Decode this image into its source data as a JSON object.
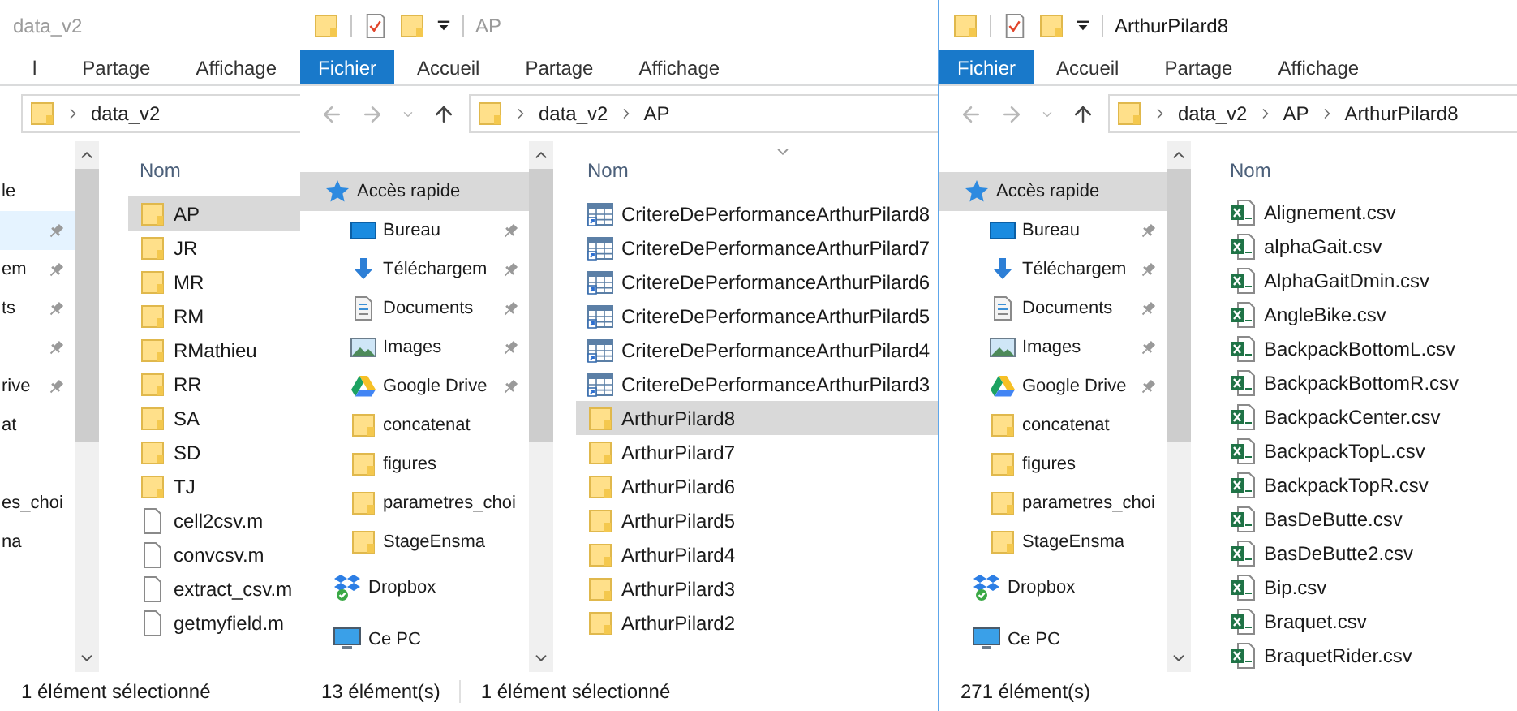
{
  "windows": [
    {
      "title": "data_v2",
      "active": false,
      "ribbon_tabs": [
        {
          "label": "l",
          "kind": "tab"
        },
        {
          "label": "Partage",
          "kind": "tab"
        },
        {
          "label": "Affichage",
          "kind": "tab"
        }
      ],
      "breadcrumb": [
        "data_v2"
      ],
      "sidebar": [
        {
          "label": "le",
          "kind": "text",
          "pinned": false,
          "selected": false,
          "hovered": false
        },
        {
          "kind": "text",
          "pinned": true,
          "selected": false,
          "hovered": true
        },
        {
          "label": "em",
          "kind": "text",
          "pinned": true,
          "selected": false,
          "hovered": false
        },
        {
          "label": "ts",
          "kind": "text",
          "pinned": true,
          "selected": false,
          "hovered": false
        },
        {
          "kind": "text",
          "pinned": true,
          "selected": false,
          "hovered": false
        },
        {
          "label": "rive",
          "kind": "text",
          "pinned": true,
          "selected": false,
          "hovered": false
        },
        {
          "label": "at",
          "kind": "text",
          "pinned": false,
          "selected": false,
          "hovered": false
        },
        {
          "kind": "text",
          "pinned": false,
          "selected": false,
          "hovered": false
        },
        {
          "label": "es_choi",
          "kind": "text",
          "pinned": false,
          "selected": false,
          "hovered": false
        },
        {
          "label": "na",
          "kind": "text",
          "pinned": false,
          "selected": false,
          "hovered": false
        }
      ],
      "column_header": "Nom",
      "files": [
        {
          "name": "AP",
          "kind": "folder",
          "selected": true
        },
        {
          "name": "JR",
          "kind": "folder",
          "selected": false
        },
        {
          "name": "MR",
          "kind": "folder",
          "selected": false
        },
        {
          "name": "RM",
          "kind": "folder",
          "selected": false
        },
        {
          "name": "RMathieu",
          "kind": "folder",
          "selected": false
        },
        {
          "name": "RR",
          "kind": "folder",
          "selected": false
        },
        {
          "name": "SA",
          "kind": "folder",
          "selected": false
        },
        {
          "name": "SD",
          "kind": "folder",
          "selected": false
        },
        {
          "name": "TJ",
          "kind": "folder",
          "selected": false
        },
        {
          "name": "cell2csv.m",
          "kind": "file",
          "selected": false
        },
        {
          "name": "convcsv.m",
          "kind": "file",
          "selected": false
        },
        {
          "name": "extract_csv.m",
          "kind": "file",
          "selected": false
        },
        {
          "name": "getmyfield.m",
          "kind": "file",
          "selected": false
        }
      ],
      "status": [
        "1 élément sélectionné"
      ]
    },
    {
      "title": "AP",
      "active": false,
      "ribbon_tabs": [
        {
          "label": "Fichier",
          "kind": "file"
        },
        {
          "label": "Accueil",
          "kind": "tab"
        },
        {
          "label": "Partage",
          "kind": "tab"
        },
        {
          "label": "Affichage",
          "kind": "tab"
        }
      ],
      "breadcrumb": [
        "data_v2",
        "AP"
      ],
      "sidebar": [
        {
          "label": "Accès rapide",
          "kind": "quick-access",
          "pinned": false,
          "selected": true
        },
        {
          "label": "Bureau",
          "kind": "desktop",
          "pinned": true,
          "selected": false
        },
        {
          "label": "Téléchargem",
          "kind": "downloads",
          "pinned": true,
          "selected": false
        },
        {
          "label": "Documents",
          "kind": "documents",
          "pinned": true,
          "selected": false
        },
        {
          "label": "Images",
          "kind": "images",
          "pinned": true,
          "selected": false
        },
        {
          "label": "Google Drive",
          "kind": "drive",
          "pinned": true,
          "selected": false
        },
        {
          "label": "concatenat",
          "kind": "folder",
          "pinned": false,
          "selected": false
        },
        {
          "label": "figures",
          "kind": "folder",
          "pinned": false,
          "selected": false
        },
        {
          "label": "parametres_choi",
          "kind": "folder",
          "pinned": false,
          "selected": false
        },
        {
          "label": "StageEnsma",
          "kind": "folder",
          "pinned": false,
          "selected": false
        },
        {
          "label": "Dropbox",
          "kind": "dropbox",
          "pinned": false,
          "selected": false
        },
        {
          "label": "Ce PC",
          "kind": "pc",
          "pinned": false,
          "selected": false
        }
      ],
      "column_header": "Nom",
      "files": [
        {
          "name": "CritereDePerformanceArthurPilard8",
          "kind": "table",
          "selected": false
        },
        {
          "name": "CritereDePerformanceArthurPilard7",
          "kind": "table",
          "selected": false
        },
        {
          "name": "CritereDePerformanceArthurPilard6",
          "kind": "table",
          "selected": false
        },
        {
          "name": "CritereDePerformanceArthurPilard5",
          "kind": "table",
          "selected": false
        },
        {
          "name": "CritereDePerformanceArthurPilard4",
          "kind": "table",
          "selected": false
        },
        {
          "name": "CritereDePerformanceArthurPilard3",
          "kind": "table",
          "selected": false
        },
        {
          "name": "ArthurPilard8",
          "kind": "folder",
          "selected": true
        },
        {
          "name": "ArthurPilard7",
          "kind": "folder",
          "selected": false
        },
        {
          "name": "ArthurPilard6",
          "kind": "folder",
          "selected": false
        },
        {
          "name": "ArthurPilard5",
          "kind": "folder",
          "selected": false
        },
        {
          "name": "ArthurPilard4",
          "kind": "folder",
          "selected": false
        },
        {
          "name": "ArthurPilard3",
          "kind": "folder",
          "selected": false
        },
        {
          "name": "ArthurPilard2",
          "kind": "folder",
          "selected": false
        }
      ],
      "status": [
        "13 élément(s)",
        "1 élément sélectionné"
      ]
    },
    {
      "title": "ArthurPilard8",
      "active": true,
      "ribbon_tabs": [
        {
          "label": "Fichier",
          "kind": "file"
        },
        {
          "label": "Accueil",
          "kind": "tab"
        },
        {
          "label": "Partage",
          "kind": "tab"
        },
        {
          "label": "Affichage",
          "kind": "tab"
        }
      ],
      "breadcrumb": [
        "data_v2",
        "AP",
        "ArthurPilard8"
      ],
      "sidebar": [
        {
          "label": "Accès rapide",
          "kind": "quick-access",
          "pinned": false,
          "selected": true
        },
        {
          "label": "Bureau",
          "kind": "desktop",
          "pinned": true,
          "selected": false
        },
        {
          "label": "Téléchargem",
          "kind": "downloads",
          "pinned": true,
          "selected": false
        },
        {
          "label": "Documents",
          "kind": "documents",
          "pinned": true,
          "selected": false
        },
        {
          "label": "Images",
          "kind": "images",
          "pinned": true,
          "selected": false
        },
        {
          "label": "Google Drive",
          "kind": "drive",
          "pinned": true,
          "selected": false
        },
        {
          "label": "concatenat",
          "kind": "folder",
          "pinned": false,
          "selected": false
        },
        {
          "label": "figures",
          "kind": "folder",
          "pinned": false,
          "selected": false
        },
        {
          "label": "parametres_choi",
          "kind": "folder",
          "pinned": false,
          "selected": false
        },
        {
          "label": "StageEnsma",
          "kind": "folder",
          "pinned": false,
          "selected": false
        },
        {
          "label": "Dropbox",
          "kind": "dropbox",
          "pinned": false,
          "selected": false
        },
        {
          "label": "Ce PC",
          "kind": "pc",
          "pinned": false,
          "selected": false
        }
      ],
      "column_header": "Nom",
      "files": [
        {
          "name": "Alignement.csv",
          "kind": "csv",
          "selected": false
        },
        {
          "name": "alphaGait.csv",
          "kind": "csv",
          "selected": false
        },
        {
          "name": "AlphaGaitDmin.csv",
          "kind": "csv",
          "selected": false
        },
        {
          "name": "AngleBike.csv",
          "kind": "csv",
          "selected": false
        },
        {
          "name": "BackpackBottomL.csv",
          "kind": "csv",
          "selected": false
        },
        {
          "name": "BackpackBottomR.csv",
          "kind": "csv",
          "selected": false
        },
        {
          "name": "BackpackCenter.csv",
          "kind": "csv",
          "selected": false
        },
        {
          "name": "BackpackTopL.csv",
          "kind": "csv",
          "selected": false
        },
        {
          "name": "BackpackTopR.csv",
          "kind": "csv",
          "selected": false
        },
        {
          "name": "BasDeButte.csv",
          "kind": "csv",
          "selected": false
        },
        {
          "name": "BasDeButte2.csv",
          "kind": "csv",
          "selected": false
        },
        {
          "name": "Bip.csv",
          "kind": "csv",
          "selected": false
        },
        {
          "name": "Braquet.csv",
          "kind": "csv",
          "selected": false
        },
        {
          "name": "BraquetRider.csv",
          "kind": "csv",
          "selected": false
        }
      ],
      "status": [
        "271 élément(s)"
      ]
    }
  ]
}
